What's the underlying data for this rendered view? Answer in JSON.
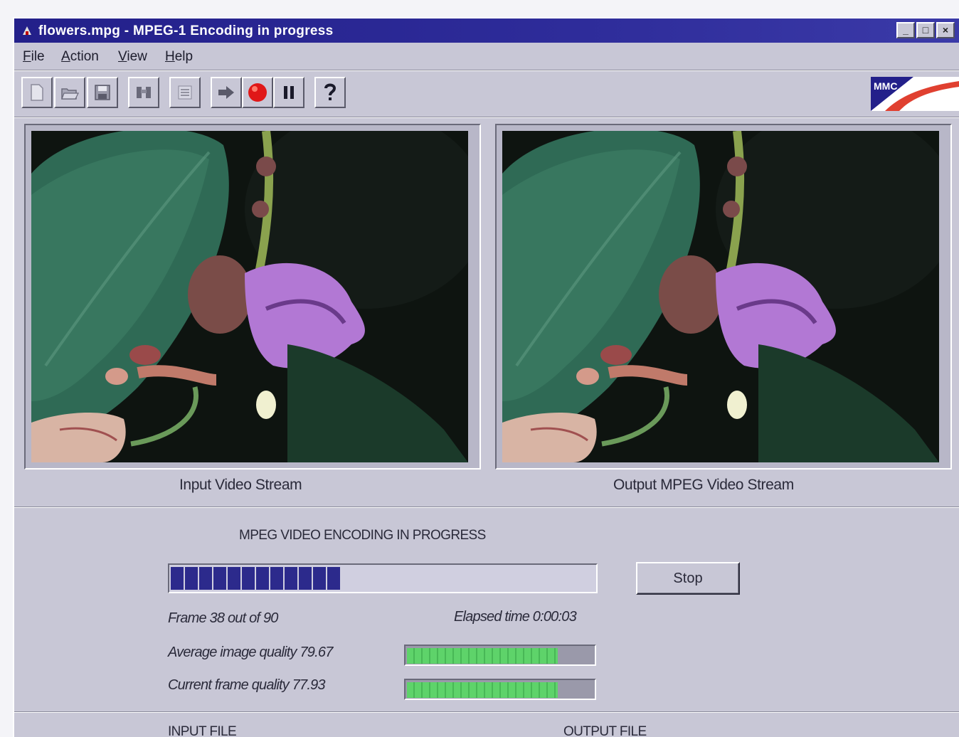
{
  "window": {
    "title": "flowers.mpg - MPEG-1 Encoding in progress",
    "controls": [
      "_",
      "□",
      "×"
    ]
  },
  "menu": [
    "File",
    "Action",
    "View",
    "Help"
  ],
  "toolbar": {
    "buttons": [
      "new-icon",
      "open-icon",
      "save-icon",
      "binoculars-icon",
      "list-icon",
      "forward-arrow-icon",
      "record-icon",
      "pause-icon",
      "help-icon"
    ],
    "logo_text": "MMC"
  },
  "video": {
    "input_caption": "Input Video Stream",
    "output_caption": "Output MPEG Video Stream"
  },
  "status": {
    "title": "MPEG VIDEO ENCODING IN PROGRESS",
    "progress_fraction": 0.42,
    "stop_label": "Stop",
    "frame_text": "Frame 38 out of 90",
    "elapsed_text": "Elapsed time 0:00:03",
    "avg_quality_text": "Average image quality 79.67",
    "avg_quality_fraction": 0.81,
    "cur_quality_text": "Current frame quality 77.93",
    "cur_quality_fraction": 0.81
  },
  "files": {
    "input_label": "INPUT FILE",
    "output_label": "OUTPUT FILE"
  },
  "colors": {
    "title_bar": "#23208a",
    "progress_fill": "#2c2a8c",
    "quality_fill": "#5ed36a",
    "record": "#e01818"
  }
}
